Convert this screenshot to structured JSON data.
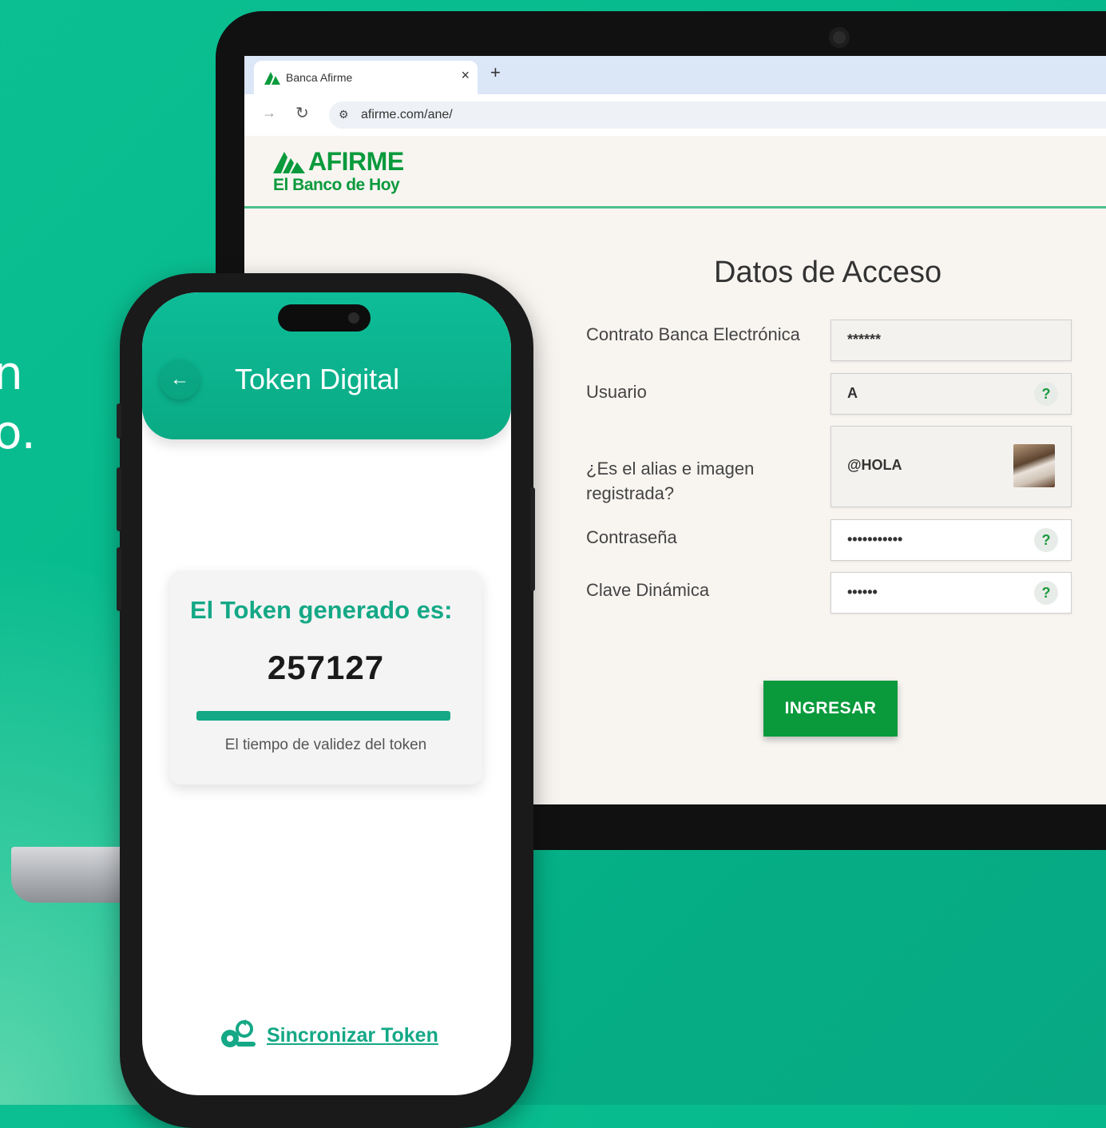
{
  "hero": {
    "line1_fragment": "n",
    "line2_fragment": "o."
  },
  "browser": {
    "tab_title": "Banca Afirme",
    "tab_close": "×",
    "new_tab": "+",
    "url": "afirme.com/ane/"
  },
  "site": {
    "brand": "AFIRME",
    "tagline": "El Banco de Hoy",
    "form_title": "Datos de Acceso",
    "fields": [
      {
        "label": "Contrato Banca Electrónica",
        "value": "******"
      },
      {
        "label": "Usuario",
        "value": "A"
      },
      {
        "label": "¿Es el alias e imagen registrada?",
        "value": "@HOLA"
      },
      {
        "label": "Contraseña",
        "value": "•••••••••••"
      },
      {
        "label": "Clave Dinámica",
        "value": "••••••"
      }
    ],
    "help_glyph": "?",
    "submit_label": "INGRESAR"
  },
  "app": {
    "title": "Token Digital",
    "back_icon": "←",
    "token_label": "El Token generado es:",
    "token_value": "257127",
    "validity_progress": 1.0,
    "validity_caption": "El tiempo de validez del token",
    "sync_label": "Sincronizar Token"
  },
  "colors": {
    "brand_green": "#0a9a3c",
    "app_teal": "#14a886",
    "background": "#06b98c"
  }
}
